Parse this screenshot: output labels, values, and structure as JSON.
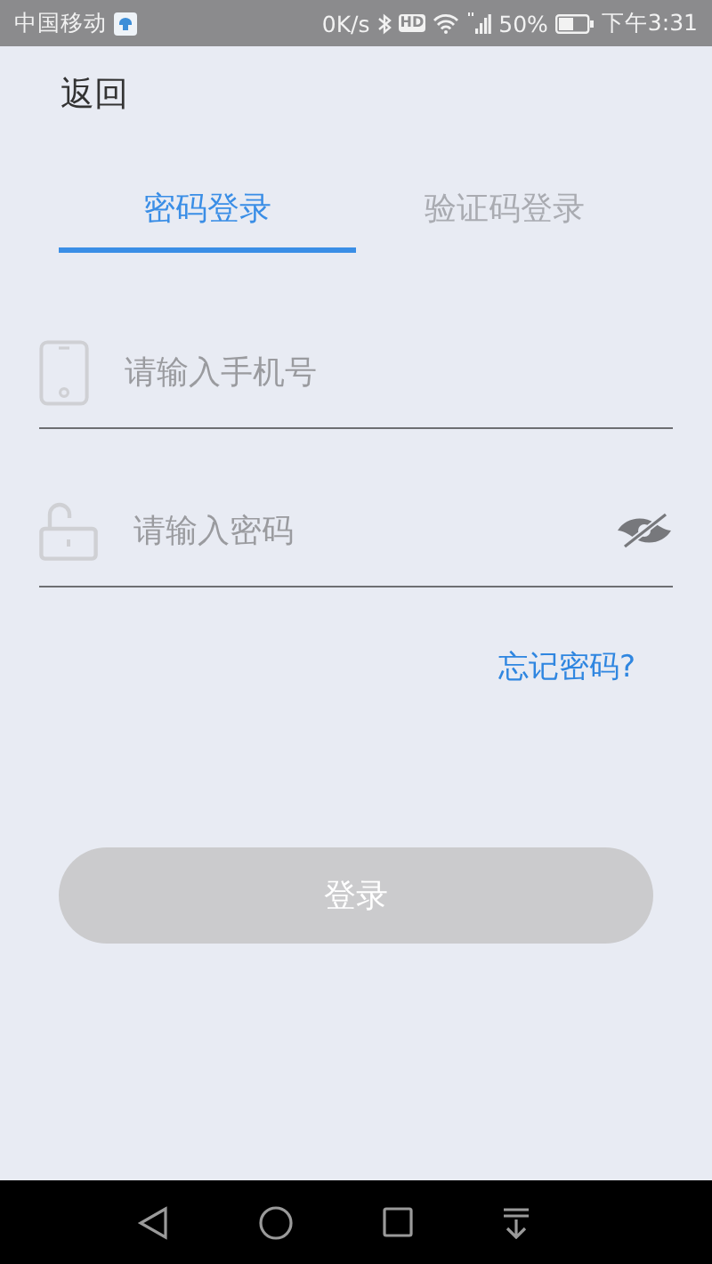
{
  "status_bar": {
    "carrier": "中国移动",
    "speed": "0K/s",
    "hd": "HD",
    "battery": "50%",
    "time": "下午3:31"
  },
  "back": "返回",
  "tabs": [
    {
      "label": "密码登录",
      "selected": true
    },
    {
      "label": "验证码登录",
      "selected": false
    }
  ],
  "fields": [
    {
      "kind": "phone",
      "placeholder": "请输入手机号"
    },
    {
      "kind": "password",
      "placeholder": "请输入密码",
      "password_visible": false
    }
  ],
  "forgot_link": "忘记密码?",
  "login_button": {
    "label": "登录",
    "disabled": true
  }
}
